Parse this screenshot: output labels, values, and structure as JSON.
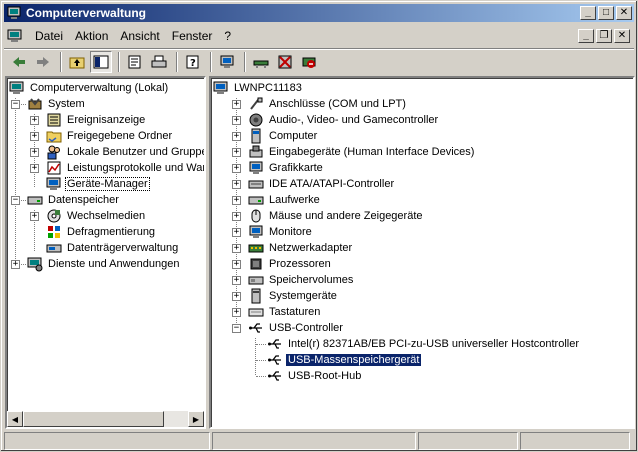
{
  "window": {
    "title": "Computerverwaltung"
  },
  "menubar": {
    "items": [
      {
        "accel": "D",
        "rest": "atei"
      },
      {
        "accel": "",
        "pre": "Ak",
        "accel2": "t",
        "rest": "ion"
      },
      {
        "accel": "A",
        "rest": "nsicht",
        "pre": ""
      },
      {
        "accel": "F",
        "rest": "enster"
      },
      {
        "accel": "?",
        "rest": ""
      }
    ],
    "labels": [
      "Datei",
      "Aktion",
      "Ansicht",
      "Fenster",
      "?"
    ]
  },
  "toolbar": {
    "buttons": [
      "back-icon",
      "forward-icon",
      "up-folder-icon",
      "show-tree-icon",
      "properties-icon",
      "print-icon",
      "help-icon",
      "scan-hardware-icon",
      "update-driver-icon",
      "uninstall-icon",
      "disable-icon"
    ]
  },
  "left_tree": {
    "root": "Computerverwaltung (Lokal)",
    "items": [
      "System",
      "Ereignisanzeige",
      "Freigegebene Ordner",
      "Lokale Benutzer und Gruppen",
      "Leistungsprotokolle und Warnungen",
      "Geräte-Manager",
      "Datenspeicher",
      "Wechselmedien",
      "Defragmentierung",
      "Datenträgerverwaltung",
      "Dienste und Anwendungen"
    ]
  },
  "right_tree": {
    "root": "LWNPC11183",
    "categories": [
      "Anschlüsse (COM und LPT)",
      "Audio-, Video- und Gamecontroller",
      "Computer",
      "Eingabegeräte (Human Interface Devices)",
      "Grafikkarte",
      "IDE ATA/ATAPI-Controller",
      "Laufwerke",
      "Mäuse und andere Zeigegeräte",
      "Monitore",
      "Netzwerkadapter",
      "Prozessoren",
      "Speichervolumes",
      "Systemgeräte",
      "Tastaturen",
      "USB-Controller"
    ],
    "usb_children": [
      "Intel(r) 82371AB/EB PCI-zu-USB universeller Hostcontroller",
      "USB-Massenspeichergerät",
      "USB-Root-Hub"
    ]
  }
}
